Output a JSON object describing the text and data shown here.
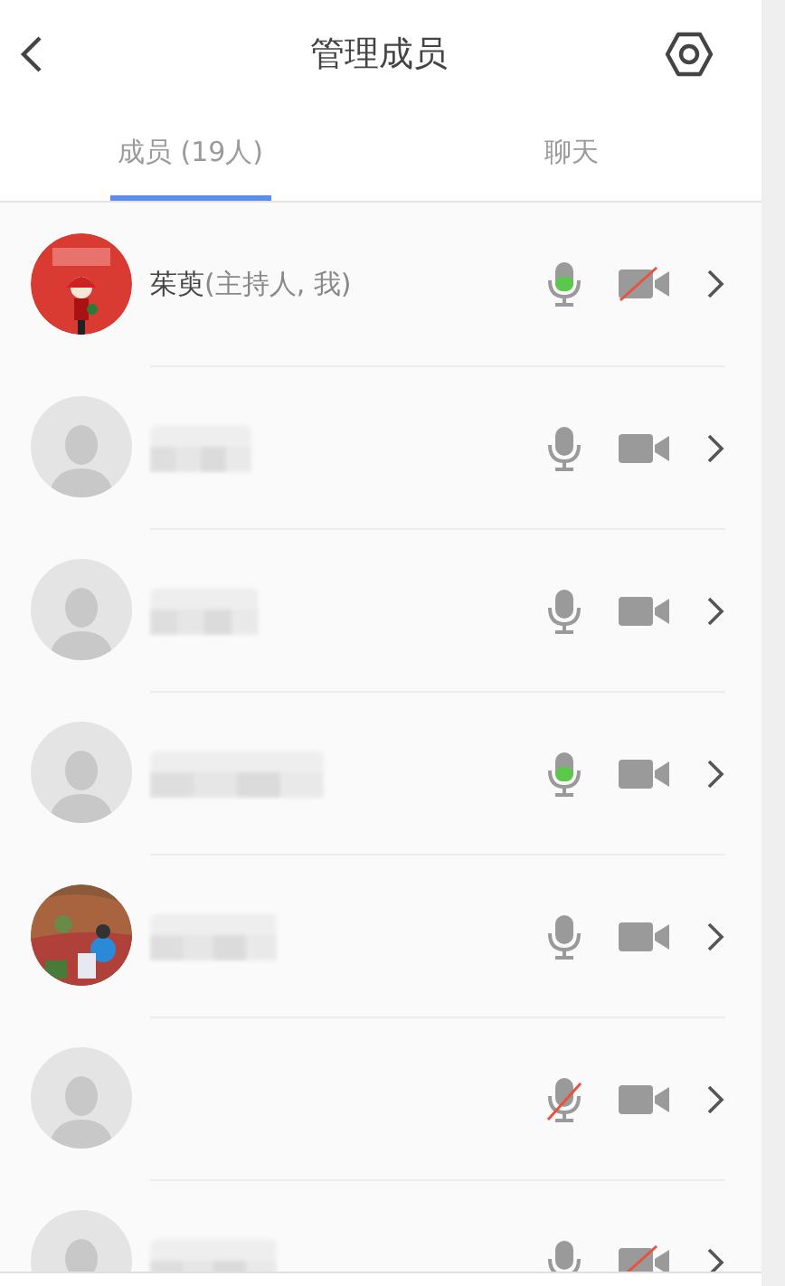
{
  "header": {
    "title": "管理成员"
  },
  "tabs": [
    {
      "label": "成员 (19人)",
      "selected": true
    },
    {
      "label": "聊天",
      "selected": false
    }
  ],
  "members": [
    {
      "photo": true,
      "name": "茱萸",
      "suffix": "(主持人, 我)",
      "blurred": false,
      "speaking": true,
      "muted": false,
      "camera_off": true
    },
    {
      "photo": false,
      "blurred": true,
      "speaking": false,
      "muted": false,
      "camera_off": false
    },
    {
      "photo": false,
      "blurred": true,
      "speaking": false,
      "muted": false,
      "camera_off": false
    },
    {
      "photo": false,
      "blurred": true,
      "speaking": true,
      "muted": false,
      "camera_off": false
    },
    {
      "photo": true,
      "blurred": true,
      "speaking": false,
      "muted": false,
      "camera_off": false
    },
    {
      "photo": false,
      "blurred": false,
      "speaking": false,
      "muted": true,
      "camera_off": false
    },
    {
      "photo": false,
      "blurred": true,
      "speaking": false,
      "muted": false,
      "camera_off": true
    }
  ]
}
